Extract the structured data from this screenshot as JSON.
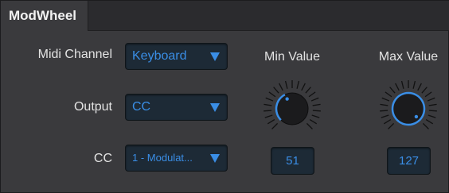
{
  "panel": {
    "tab_title": "ModWheel"
  },
  "rows": {
    "midi_channel": {
      "label": "Midi Channel",
      "value": "Keyboard"
    },
    "output": {
      "label": "Output",
      "value": "CC"
    },
    "cc": {
      "label": "CC",
      "value": "1 - Modulat..."
    }
  },
  "min_value": {
    "label": "Min Value",
    "value": "51",
    "fraction": 0.4
  },
  "max_value": {
    "label": "Max Value",
    "value": "127",
    "fraction": 1.0
  },
  "colors": {
    "accent": "#3a8ee6",
    "field_bg": "#1d2a36",
    "panel_bg": "#3a3a3d"
  },
  "icons": {
    "dropdown_arrow": "triangle-down-icon"
  }
}
